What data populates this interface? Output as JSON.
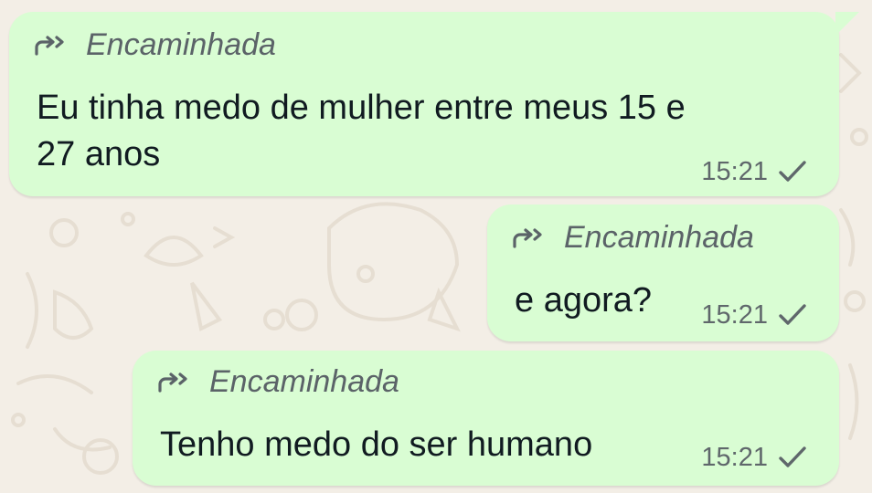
{
  "colors": {
    "bubble_outgoing": "#d9fdd3",
    "wallpaper": "#f3eee6",
    "text_primary": "#111b21",
    "text_secondary": "#5f676b"
  },
  "messages": [
    {
      "forwarded_label": "Encaminhada",
      "forwarded_icon": "forward-arrow-icon",
      "text_lines": [
        "Eu tinha medo de mulher entre meus 15 e",
        "27 anos"
      ],
      "time": "15:21",
      "status_icon": "single-check-icon"
    },
    {
      "forwarded_label": "Encaminhada",
      "forwarded_icon": "forward-arrow-icon",
      "text_lines": [
        "e agora?"
      ],
      "time": "15:21",
      "status_icon": "single-check-icon"
    },
    {
      "forwarded_label": "Encaminhada",
      "forwarded_icon": "forward-arrow-icon",
      "text_lines": [
        "Tenho medo do ser humano"
      ],
      "time": "15:21",
      "status_icon": "single-check-icon"
    }
  ]
}
